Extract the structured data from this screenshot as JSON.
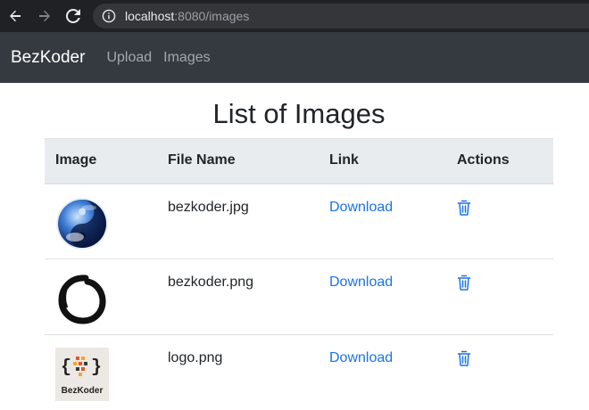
{
  "browser": {
    "url_host": "localhost",
    "url_rest": ":8080/images"
  },
  "navbar": {
    "brand": "BezKoder",
    "links": [
      "Upload",
      "Images"
    ]
  },
  "page": {
    "title": "List of Images"
  },
  "table": {
    "headers": [
      "Image",
      "File Name",
      "Link",
      "Actions"
    ],
    "rows": [
      {
        "file_name": "bezkoder.jpg",
        "link": "Download"
      },
      {
        "file_name": "bezkoder.png",
        "link": "Download"
      },
      {
        "file_name": "logo.png",
        "link": "Download",
        "logo_text": "BezKoder"
      }
    ]
  },
  "colors": {
    "browser_bg": "#202124",
    "navbar_bg": "#343a40",
    "link": "#1a73e8",
    "header_bg": "#e9ecef"
  }
}
